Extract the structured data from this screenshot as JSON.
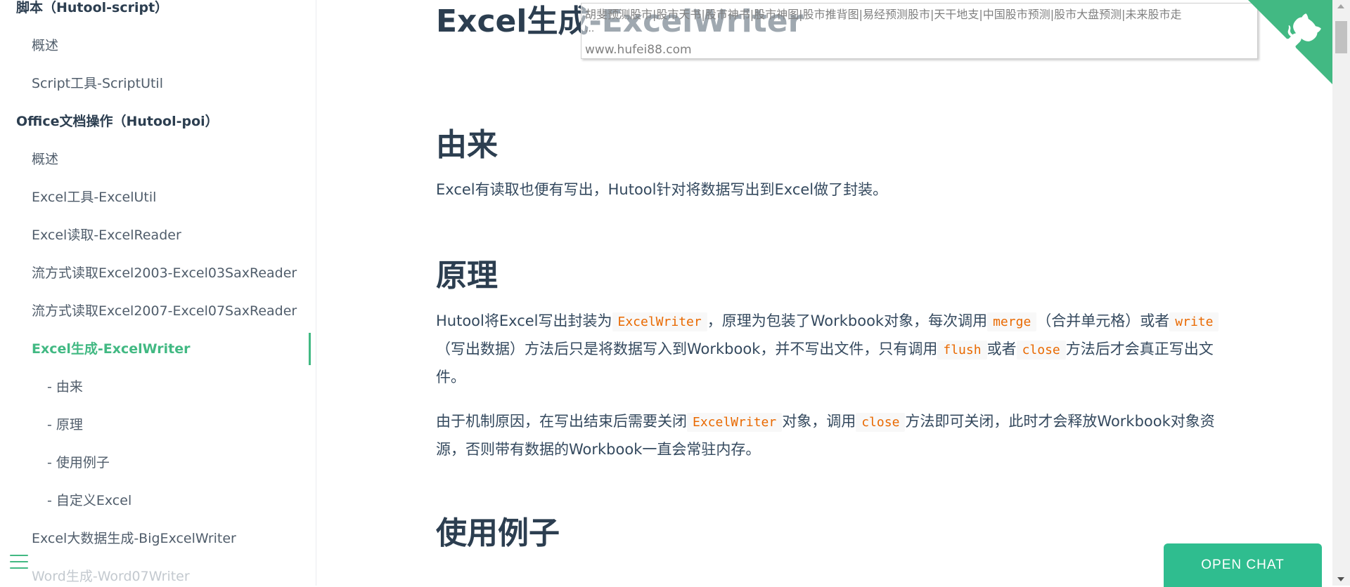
{
  "sidebar": {
    "items": [
      {
        "label": "脚本（Hutool-script）"
      },
      {
        "label": "概述"
      },
      {
        "label": "Script工具-ScriptUtil"
      },
      {
        "label": "Office文档操作（Hutool-poi）"
      },
      {
        "label": "概述"
      },
      {
        "label": "Excel工具-ExcelUtil"
      },
      {
        "label": "Excel读取-ExcelReader"
      },
      {
        "label": "流方式读取Excel2003-Excel03SaxReader"
      },
      {
        "label": "流方式读取Excel2007-Excel07SaxReader"
      },
      {
        "label": "Excel生成-ExcelWriter"
      },
      {
        "label": "- 由来"
      },
      {
        "label": "- 原理"
      },
      {
        "label": "- 使用例子"
      },
      {
        "label": "- 自定义Excel"
      },
      {
        "label": "Excel大数据生成-BigExcelWriter"
      },
      {
        "label": "Word生成-Word07Writer"
      }
    ],
    "menu_icon": "hamburger-icon",
    "accent_color": "#42b983"
  },
  "main": {
    "title": "Excel生成-ExcelWriter",
    "sections": {
      "origin": {
        "heading": "由来",
        "text": "Excel有读取也便有写出，Hutool针对将数据写出到Excel做了封装。"
      },
      "principle": {
        "heading": "原理",
        "p1": {
          "t1": "Hutool将Excel写出封装为",
          "c1": "ExcelWriter",
          "t2": "，原理为包装了Workbook对象，每次调用",
          "c2": "merge",
          "t3": "（合并单元格）或者",
          "c3": "write",
          "t4": "（写出数据）方法后只是将数据写入到Workbook，并不写出文件，只有调用",
          "c4": "flush",
          "t5": "或者",
          "c5": "close",
          "t6": "方法后才会真正写出文件。"
        },
        "p2": {
          "t1": "由于机制原因，在写出结束后需要关闭",
          "c1": "ExcelWriter",
          "t2": "对象，调用",
          "c2": "close",
          "t3": "方法即可关闭，此时才会释放Workbook对象资源，否则带有数据的Workbook一直会常驻内存。"
        }
      },
      "examples": {
        "heading": "使用例子"
      }
    }
  },
  "tooltip": {
    "title": "胡斐预测股市|股市天书|股市神书|股市神图|股市推背图|易经预测股市|天干地支|中国股市预测|股市大盘预测|未来股市走",
    "ellipsis": "...",
    "url": "www.hufei88.com"
  },
  "github_corner": {
    "icon": "github-octocat-icon",
    "color": "#42b983"
  },
  "chat": {
    "label": "OPEN CHAT",
    "color": "#2fbd8f"
  }
}
